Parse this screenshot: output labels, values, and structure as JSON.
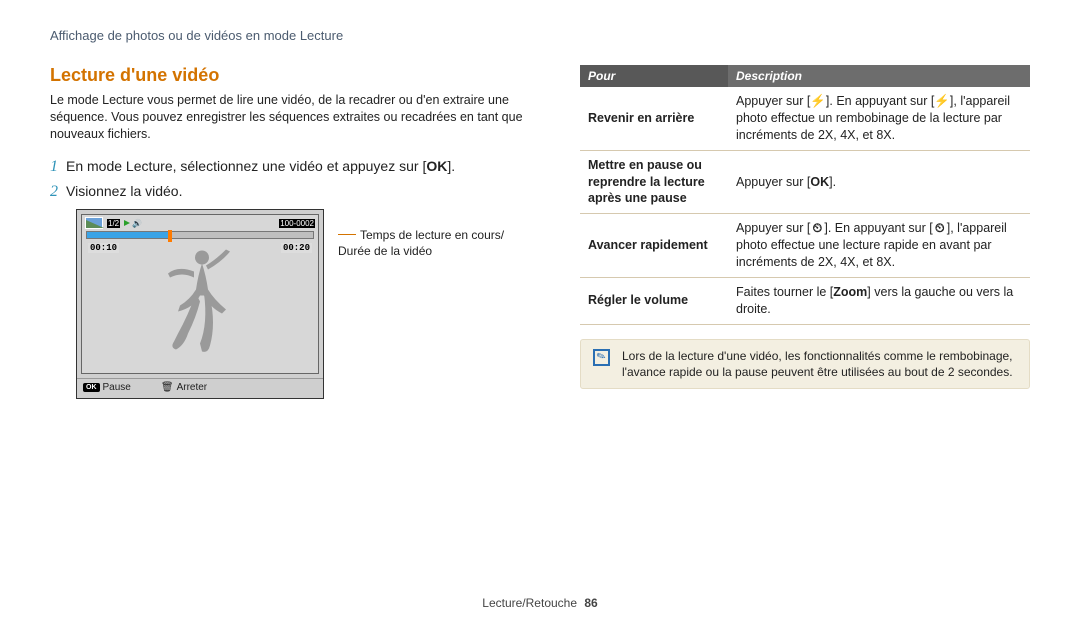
{
  "breadcrumb": "Affichage de photos ou de vidéos en mode Lecture",
  "section_title": "Lecture d'une vidéo",
  "intro": "Le mode Lecture vous permet de lire une vidéo, de la recadrer ou d'en extraire une séquence. Vous pouvez enregistrer les séquences extraites ou recadrées en tant que nouveaux fichiers.",
  "steps": [
    {
      "num": "1",
      "pre": "En mode Lecture, sélectionnez une vidéo et appuyez sur [",
      "ok": "OK",
      "post": "]."
    },
    {
      "num": "2",
      "pre": "Visionnez la vidéo.",
      "ok": "",
      "post": ""
    }
  ],
  "lcd": {
    "counter": "1/2",
    "file_info": "100-0002",
    "cur_time": "00:10",
    "dur_time": "00:20",
    "btn_ok": "OK",
    "pause_label": "Pause",
    "stop_label": "Arreter"
  },
  "callout": {
    "line1": "Temps de lecture en cours/",
    "line2": "Durée de la vidéo"
  },
  "table": {
    "h1": "Pour",
    "h2": "Description",
    "rows": [
      {
        "k": "Revenir en arrière",
        "d_parts": [
          "Appuyer sur [",
          "SYM_FLASH",
          "]. En appuyant sur [",
          "SYM_FLASH",
          "], l'appareil photo effectue un rembobinage de la lecture par incréments de 2X, 4X, et 8X."
        ]
      },
      {
        "k": "Mettre en pause ou reprendre la lecture après une pause",
        "d_parts": [
          "Appuyer sur [",
          "SYM_OK",
          "]."
        ]
      },
      {
        "k": "Avancer rapidement",
        "d_parts": [
          "Appuyer sur [",
          "SYM_TIMER",
          "]. En appuyant sur [",
          "SYM_TIMER",
          "], l'appareil photo effectue une lecture rapide en avant par incréments de 2X, 4X, et 8X."
        ]
      },
      {
        "k": "Régler le volume",
        "d_parts": [
          "Faites tourner le [",
          "BOLD_Zoom",
          "] vers la gauche ou vers la droite."
        ]
      }
    ]
  },
  "note": "Lors de la lecture d'une vidéo, les fonctionnalités comme le rembobinage, l'avance rapide ou la pause peuvent être utilisées au bout de 2 secondes.",
  "footer": {
    "label": "Lecture/Retouche",
    "page": "86"
  },
  "symbols": {
    "SYM_FLASH": "⚡",
    "SYM_OK": "OK",
    "SYM_TIMER": "⏲",
    "BOLD_Zoom": "Zoom"
  }
}
